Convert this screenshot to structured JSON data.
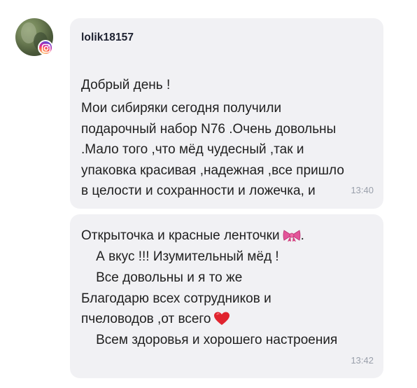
{
  "messages": [
    {
      "sender": "lolik18157",
      "lines": [
        "Добрый день !",
        "Мои сибиряки сегодня получили",
        "подарочный набор N76 .Очень довольны",
        ".Мало того ,что мёд чудесный ,так и",
        "упаковка красивая ,надежная ,все пришло",
        "в целости и сохранности и ложечка, и"
      ],
      "time": "13:40"
    },
    {
      "lines": [
        "Открыточка и красные ленточки",
        "    А вкус !!! Изумительный мёд !",
        "    Все довольны и я то же",
        "Благодарю всех сотрудников и",
        "пчеловодов ,от всего",
        "    Всем здоровья и хорошего настроения"
      ],
      "line_suffix_1": ".",
      "time": "13:42"
    }
  ],
  "icons": {
    "avatar": "user-avatar-photo",
    "badge": "instagram-icon",
    "ribbon": "ribbon-emoji-icon",
    "heart": "red-heart-emoji-icon"
  },
  "colors": {
    "bubble": "#f1f1f4",
    "text": "#1f1f1f",
    "time": "#9aa0ab",
    "heart": "#e0242f",
    "ribbon": "#e3559a"
  }
}
